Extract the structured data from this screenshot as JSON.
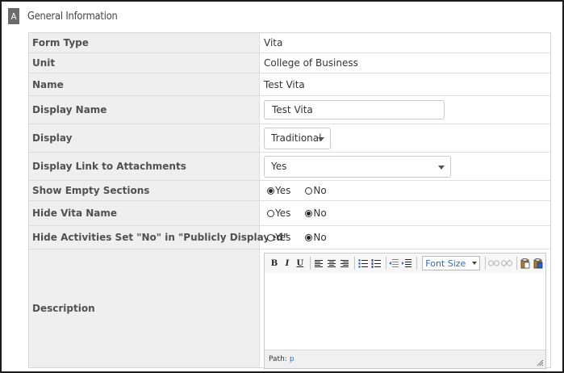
{
  "section": {
    "badge": "A",
    "title": "General Information"
  },
  "fields": {
    "form_type": {
      "label": "Form Type",
      "value": "Vita"
    },
    "unit": {
      "label": "Unit",
      "value": "College of Business"
    },
    "name": {
      "label": "Name",
      "value": "Test Vita"
    },
    "display_name": {
      "label": "Display Name",
      "value": "Test Vita"
    },
    "display": {
      "label": "Display",
      "value": "Traditional"
    },
    "display_link": {
      "label": "Display Link to Attachments",
      "value": "Yes"
    },
    "show_empty": {
      "label": "Show Empty Sections",
      "yes": "Yes",
      "no": "No",
      "selected": "Yes"
    },
    "hide_vita_name": {
      "label": "Hide Vita Name",
      "yes": "Yes",
      "no": "No",
      "selected": "No"
    },
    "hide_activities": {
      "label": "Hide Activities Set \"No\" in \"Publicly Displayed\"",
      "yes": "Yes",
      "no": "No",
      "selected": "No"
    },
    "description": {
      "label": "Description"
    }
  },
  "editor": {
    "font_size_label": "Font Size",
    "path_label": "Path:",
    "path_value": "p",
    "tools": {
      "bold": "B",
      "italic": "I",
      "underline": "U"
    },
    "icons": [
      "bold-icon",
      "italic-icon",
      "underline-icon",
      "align-left-icon",
      "align-center-icon",
      "align-right-icon",
      "bullet-list-icon",
      "numbered-list-icon",
      "outdent-icon",
      "indent-icon",
      "link-icon",
      "unlink-icon",
      "paste-icon",
      "paste-word-icon"
    ]
  },
  "colors": {
    "label_bg": "#efefef",
    "badge_bg": "#6b6b6b",
    "link": "#3366bb"
  }
}
